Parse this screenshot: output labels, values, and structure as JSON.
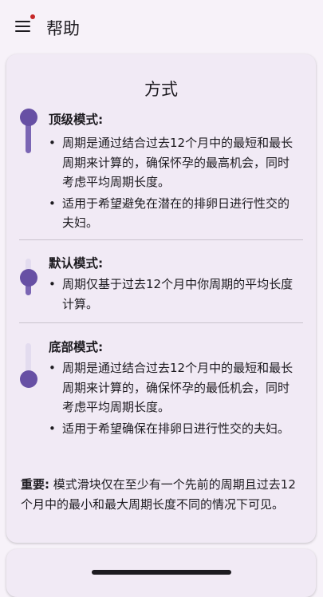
{
  "header": {
    "title": "帮助"
  },
  "card": {
    "title": "方式",
    "sections": [
      {
        "heading": "顶级模式:",
        "bullets": [
          "周期是通过结合过去12个月中的最短和最长周期来计算的，确保怀孕的最高机会，同时考虑平均周期长度。",
          "适用于希望避免在潜在的排卵日进行性交的夫妇。"
        ],
        "slider_level": 1.0
      },
      {
        "heading": "默认模式:",
        "bullets": [
          "周期仅基于过去12个月中你周期的平均长度计算。"
        ],
        "slider_level": 0.5
      },
      {
        "heading": "底部模式:",
        "bullets": [
          "周期是通过结合过去12个月中的最短和最长周期来计算的，确保怀孕的最低机会，同时考虑平均周期长度。",
          "适用于希望确保在排卵日进行性交的夫妇。"
        ],
        "slider_level": 0.0
      }
    ],
    "important_label": "重要:",
    "important_text": "模式滑块仅在至少有一个先前的周期且过去12个月中的最小和最大周期长度不同的情况下可见。"
  },
  "colors": {
    "accent": "#6750a4",
    "track_active": "#7b66b4",
    "track_inactive": "#e3dcef",
    "notification_dot": "#c62828"
  },
  "icons": {
    "menu": "menu-icon"
  }
}
